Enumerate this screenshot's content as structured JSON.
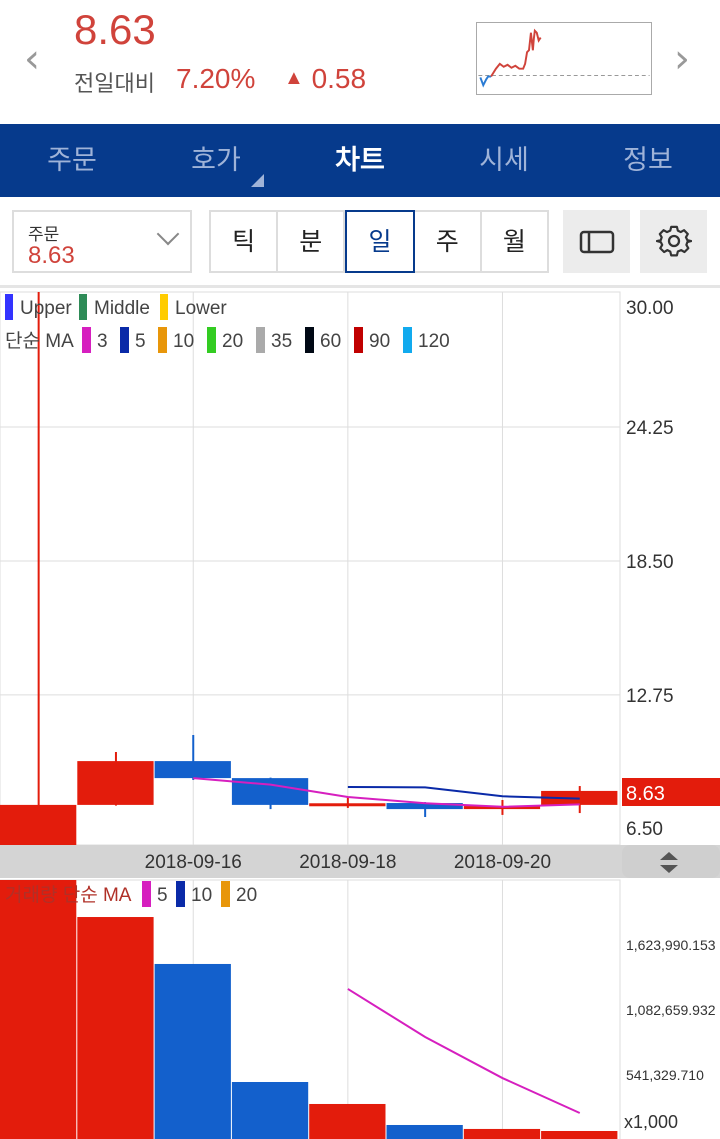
{
  "header": {
    "price": "8.63",
    "compare_label": "전일대비",
    "change_pct": "7.20%",
    "change_arrow": "▲",
    "change_value": "0.58",
    "prev_icon": "chevron-left-icon",
    "next_icon": "chevron-right-icon"
  },
  "nav": {
    "tabs": [
      {
        "label": "주문"
      },
      {
        "label": "호가"
      },
      {
        "label": "차트",
        "active": true
      },
      {
        "label": "시세"
      },
      {
        "label": "정보"
      }
    ]
  },
  "toolbar": {
    "order_label": "주문",
    "order_value": "8.63",
    "periods": [
      "틱",
      "분",
      "일",
      "주",
      "월"
    ],
    "selected_period": "일",
    "layout_icon": "panel-layout-icon",
    "settings_icon": "gear-icon"
  },
  "colors": {
    "up": "#e31c0c",
    "down": "#1360cc",
    "nav": "#063a8c",
    "price_text": "#d0433b"
  },
  "chart_data": [
    {
      "type": "candlestick",
      "title": "price",
      "legend_bands": [
        {
          "label": "Upper",
          "color": "#3333ff"
        },
        {
          "label": "Middle",
          "color": "#2e8b57"
        },
        {
          "label": "Lower",
          "color": "#ffcc00"
        }
      ],
      "ma_label": "단순 MA",
      "ma_legend": [
        {
          "label": "3",
          "color": "#d61fbf"
        },
        {
          "label": "5",
          "color": "#0a2aa8"
        },
        {
          "label": "10",
          "color": "#e8960a"
        },
        {
          "label": "20",
          "color": "#33cc22"
        },
        {
          "label": "35",
          "color": "#aaaaaa"
        },
        {
          "label": "60",
          "color": "#000814"
        },
        {
          "label": "90",
          "color": "#c00000"
        },
        {
          "label": "120",
          "color": "#11aaee"
        }
      ],
      "yticks": [
        "30.00",
        "24.25",
        "18.50",
        "12.75",
        "6.50"
      ],
      "ylim": [
        6.5,
        30
      ],
      "xticks": [
        {
          "index": 2,
          "label": "2018-09-16"
        },
        {
          "index": 4,
          "label": "2018-09-18"
        },
        {
          "index": 6,
          "label": "2018-09-20"
        }
      ],
      "candles": [
        {
          "o": 6.3,
          "h": 31,
          "l": 6.3,
          "c": 8.03
        },
        {
          "o": 8.03,
          "h": 10.3,
          "l": 8.0,
          "c": 9.91
        },
        {
          "o": 9.91,
          "h": 11.03,
          "l": 9.1,
          "c": 9.18
        },
        {
          "o": 9.18,
          "h": 9.2,
          "l": 7.85,
          "c": 8.03
        },
        {
          "o": 7.98,
          "h": 8.37,
          "l": 7.9,
          "c": 8.1
        },
        {
          "o": 8.11,
          "h": 8.15,
          "l": 7.51,
          "c": 7.85
        },
        {
          "o": 7.85,
          "h": 8.24,
          "l": 7.6,
          "c": 7.98
        },
        {
          "o": 8.03,
          "h": 8.84,
          "l": 7.68,
          "c": 8.63
        }
      ],
      "ma3": [
        null,
        null,
        9.18,
        8.9,
        8.37,
        8.1,
        7.95,
        8.05
      ],
      "ma5": [
        null,
        null,
        null,
        null,
        8.8,
        8.78,
        8.4,
        8.3
      ],
      "last_price": "8.63"
    },
    {
      "type": "bar",
      "title": "volume",
      "label": "거래량 단순 MA",
      "ma_legend": [
        {
          "label": "5",
          "color": "#d61fbf"
        },
        {
          "label": "10",
          "color": "#0a2aa8"
        },
        {
          "label": "20",
          "color": "#e8960a"
        }
      ],
      "yticks": [
        "1,623,990.153",
        "1,082,659.932",
        "541,329.710"
      ],
      "unit": "x1,000",
      "ylim": [
        0,
        2180000
      ],
      "values": [
        2400000,
        1857000,
        1466000,
        483000,
        300000,
        125000,
        92000,
        75000
      ],
      "ma5": [
        null,
        null,
        null,
        null,
        1258000,
        858000,
        516000,
        225000
      ]
    }
  ]
}
